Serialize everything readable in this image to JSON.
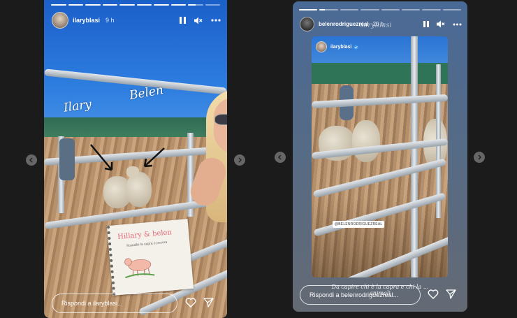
{
  "left_story": {
    "username": "ilaryblasi",
    "time": "9 h",
    "progress": [
      1,
      1,
      1,
      1,
      1,
      1,
      1,
      1,
      0.5,
      0
    ],
    "stickers": {
      "ilary": "Ilary",
      "belen": "Belen"
    },
    "drawing": {
      "title": "Hillary & belen",
      "subtitle": "ilcauallo la capra e pecora"
    },
    "reply_placeholder": "Rispondi a ilaryblasi..."
  },
  "right_story": {
    "username": "belenrodriguezreal",
    "time": "20 h",
    "overlay_username": "ilaryblasi",
    "progress": [
      1,
      0.3,
      0,
      0,
      0,
      0,
      0,
      0
    ],
    "embedded": {
      "username": "ilaryblasi",
      "verified": true,
      "mention": "@BELENRODRIGUEZREAL"
    },
    "caption": "Da capire chi è la capra e chi la ... animali",
    "reply_placeholder": "Rispondi a belenrodriguezreal..."
  },
  "icons": {
    "pause": "pause-icon",
    "mute": "speaker-muted-icon",
    "more": "more-horizontal-icon",
    "like": "heart-icon",
    "share": "send-icon",
    "prev": "chevron-left-icon",
    "next": "chevron-right-icon"
  }
}
